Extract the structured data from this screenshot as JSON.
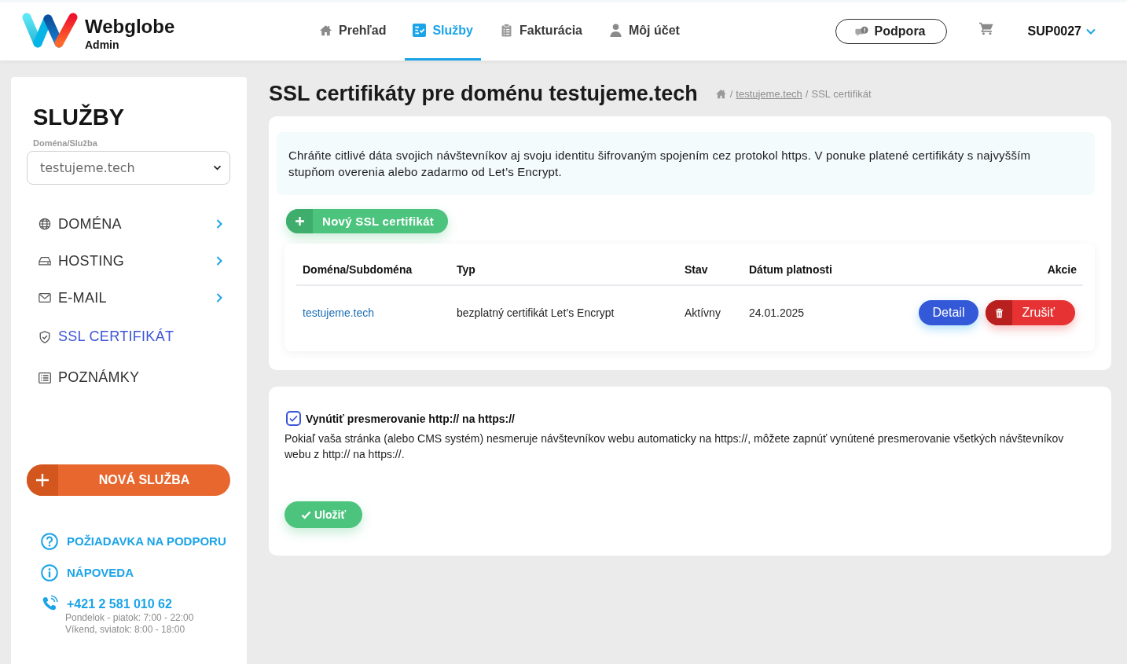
{
  "header": {
    "brand": {
      "name": "Webglobe",
      "subtitle": "Admin"
    },
    "nav": [
      {
        "label": "Prehľad",
        "selected": false
      },
      {
        "label": "Služby",
        "selected": true
      },
      {
        "label": "Fakturácia",
        "selected": false
      },
      {
        "label": "Môj účet",
        "selected": false
      }
    ],
    "support_button": "Podpora",
    "account": "SUP0027"
  },
  "sidebar": {
    "title": "SLUŽBY",
    "select": {
      "label": "Doména/Služba",
      "value": "testujeme.tech"
    },
    "items": [
      {
        "label": "DOMÉNA",
        "selected": false,
        "expandable": true
      },
      {
        "label": "HOSTING",
        "selected": false,
        "expandable": true
      },
      {
        "label": "E-MAIL",
        "selected": false,
        "expandable": true
      },
      {
        "label": "SSL CERTIFIKÁT",
        "selected": true,
        "expandable": false
      },
      {
        "label": "POZNÁMKY",
        "selected": false,
        "expandable": false
      }
    ],
    "new_service_button": "NOVÁ SLUŽBA",
    "help_links": [
      "POŽIADAVKA NA PODPORU",
      "NÁPOVEDA"
    ],
    "phone": {
      "number": "+421 2 581 010 62",
      "hours": [
        "Pondelok - piatok: 7:00 - 22:00",
        "Víkend, sviatok: 8:00 - 18:00"
      ]
    }
  },
  "page": {
    "title": "SSL certifikáty pre doménu testujeme.tech",
    "breadcrumb": {
      "separator": "/",
      "items": [
        {
          "label": "testujeme.tech",
          "link": true
        },
        {
          "label": "SSL certifikát",
          "link": false
        }
      ]
    }
  },
  "certificates": {
    "info": "Chráňte citlivé dáta svojich návštevníkov aj svoju identitu šifrovaným spojením cez protokol https. V ponuke platené certifikáty s najvyšším stupňom overenia alebo zadarmo od Let’s Encrypt.",
    "new_button": "Nový SSL certifikát",
    "table": {
      "columns": [
        "Doména/Subdoména",
        "Typ",
        "Stav",
        "Dátum platnosti",
        "Akcie"
      ],
      "rows": [
        {
          "cells": [
            "testujeme.tech",
            "bezplatný certifikát Let’s Encrypt",
            "Aktívny",
            "24.01.2025"
          ],
          "actions": [
            {
              "label": "Detail",
              "kind": "primary"
            },
            {
              "label": "Zrušiť",
              "kind": "danger"
            }
          ]
        }
      ]
    }
  },
  "redirect": {
    "checkbox": {
      "label": "Vynútiť presmerovanie http:// na https://",
      "checked": true
    },
    "description": "Pokiaľ vaša stránka (alebo CMS systém) nesmeruje návštevníkov webu automaticky na https://, môžete zapnúť vynútené presmerovanie všetkých návštevníkov webu z http:// na https://.",
    "save_button": "Uložiť"
  }
}
